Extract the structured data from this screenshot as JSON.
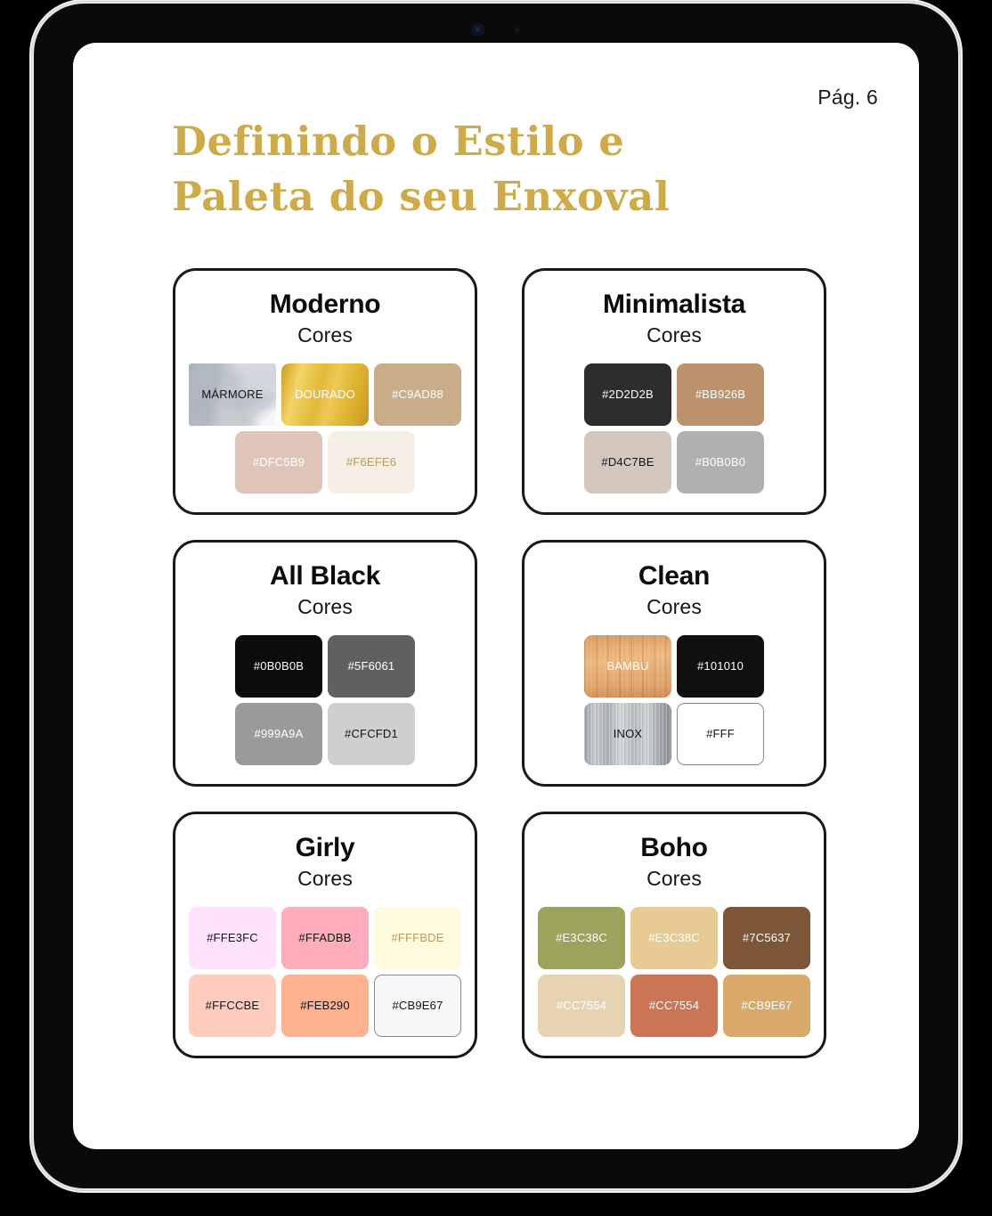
{
  "device": {
    "camera_icon": "front-camera-icon",
    "sensor_icon": "ambient-sensor-icon"
  },
  "page": {
    "page_number": "Pág. 6",
    "title_line1": "Definindo o Estilo e",
    "title_line2": "Paleta do seu Enxoval",
    "title_color": "#CFAB47"
  },
  "cards": [
    {
      "name": "Moderno",
      "subtitle": "Cores",
      "rows": [
        [
          {
            "label": "MÁRMORE",
            "texture": "marmore",
            "text_tone": "dark",
            "square": true
          },
          {
            "label": "DOURADO",
            "texture": "dourado",
            "text_tone": "light"
          },
          {
            "label": "#C9AD88",
            "color": "#C9AD88",
            "text_tone": "light"
          }
        ],
        [
          {
            "label": "#DFC5B9",
            "color": "#DFC5B9",
            "text_tone": "light"
          },
          {
            "label": "#F6EFE6",
            "color": "#F6EFE6",
            "text_tone": "gold"
          }
        ]
      ]
    },
    {
      "name": "Minimalista",
      "subtitle": "Cores",
      "rows": [
        [
          {
            "label": "#2D2D2B",
            "color": "#2D2D2B",
            "text_tone": "light"
          },
          {
            "label": "#BB926B",
            "color": "#BB926B",
            "text_tone": "light"
          }
        ],
        [
          {
            "label": "#D4C7BE",
            "color": "#D4C7BE",
            "text_tone": "dark"
          },
          {
            "label": "#B0B0B0",
            "color": "#B0B0B0",
            "text_tone": "light"
          }
        ]
      ]
    },
    {
      "name": "All Black",
      "subtitle": "Cores",
      "rows": [
        [
          {
            "label": "#0B0B0B",
            "color": "#0B0B0B",
            "text_tone": "light"
          },
          {
            "label": "#5F6061",
            "color": "#5F6061",
            "text_tone": "light"
          }
        ],
        [
          {
            "label": "#999A9A",
            "color": "#999A9A",
            "text_tone": "light"
          },
          {
            "label": "#CFCFD1",
            "color": "#CFCFD1",
            "text_tone": "dark"
          }
        ]
      ]
    },
    {
      "name": "Clean",
      "subtitle": "Cores",
      "rows": [
        [
          {
            "label": "BAMBU",
            "texture": "bambu",
            "text_tone": "light"
          },
          {
            "label": "#101010",
            "color": "#101010",
            "text_tone": "light"
          }
        ],
        [
          {
            "label": "INOX",
            "texture": "inox",
            "text_tone": "dark"
          },
          {
            "label": "#FFF",
            "color": "#FFFFFF",
            "text_tone": "dark",
            "outlined": true
          }
        ]
      ]
    },
    {
      "name": "Girly",
      "subtitle": "Cores",
      "rows": [
        [
          {
            "label": "#FFE3FC",
            "color": "#FFE3FC",
            "text_tone": "dark"
          },
          {
            "label": "#FFADBB",
            "color": "#FFADBB",
            "text_tone": "dark"
          },
          {
            "label": "#FFFBDE",
            "color": "#FFFBDE",
            "text_tone": "gold"
          }
        ],
        [
          {
            "label": "#FFCCBE",
            "color": "#FFCCBE",
            "text_tone": "dark"
          },
          {
            "label": "#FEB290",
            "color": "#FEB290",
            "text_tone": "dark"
          },
          {
            "label": "#CB9E67",
            "color": "#F7F7F7",
            "text_tone": "dark",
            "outlined": true
          }
        ]
      ]
    },
    {
      "name": "Boho",
      "subtitle": "Cores",
      "rows": [
        [
          {
            "label": "#E3C38C",
            "color": "#9CA35C",
            "text_tone": "light"
          },
          {
            "label": "#E3C38C",
            "color": "#E7CB93",
            "text_tone": "light"
          },
          {
            "label": "#7C5637",
            "color": "#7C5637",
            "text_tone": "light"
          }
        ],
        [
          {
            "label": "#CC7554",
            "color": "#E6D3B2",
            "text_tone": "light"
          },
          {
            "label": "#CC7554",
            "color": "#CC7554",
            "text_tone": "light"
          },
          {
            "label": "#CB9E67",
            "color": "#D9A96B",
            "text_tone": "light"
          }
        ]
      ]
    }
  ]
}
